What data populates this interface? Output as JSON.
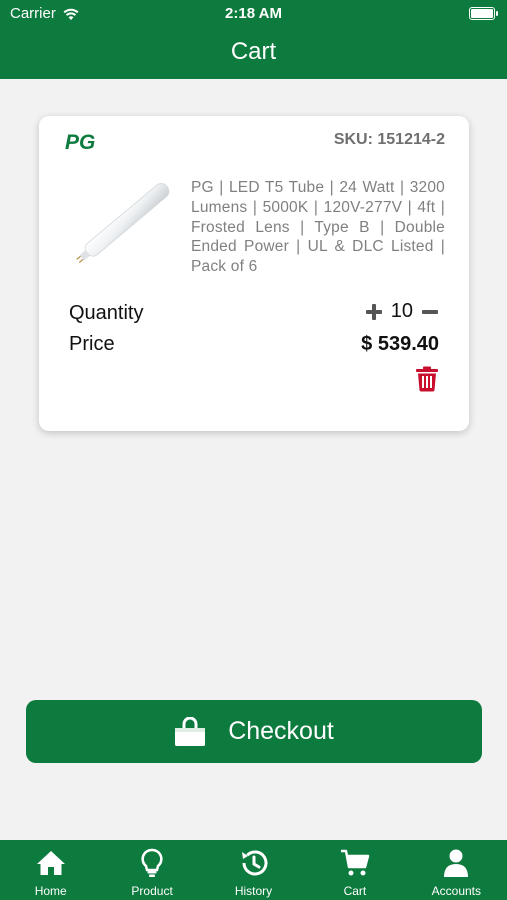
{
  "status_bar": {
    "carrier": "Carrier",
    "time": "2:18 AM"
  },
  "header": {
    "title": "Cart"
  },
  "cart_item": {
    "brand": "PG",
    "sku": "SKU: 151214-2",
    "description": "PG | LED T5 Tube | 24 Watt | 3200 Lumens | 5000K | 120V-277V | 4ft | Frosted Lens | Type B | Double Ended Power | UL & DLC Listed | Pack of 6",
    "quantity_label": "Quantity",
    "quantity": "10",
    "price_label": "Price",
    "price": "$ 539.40"
  },
  "checkout": {
    "label": "Checkout"
  },
  "tabs": [
    {
      "label": "Home",
      "icon": "home-icon"
    },
    {
      "label": "Product",
      "icon": "lightbulb-icon"
    },
    {
      "label": "History",
      "icon": "history-icon"
    },
    {
      "label": "Cart",
      "icon": "cart-icon"
    },
    {
      "label": "Accounts",
      "icon": "user-icon"
    }
  ],
  "colors": {
    "primary": "#0d7a3e",
    "delete": "#c8102e",
    "background": "#f2f2f2"
  }
}
